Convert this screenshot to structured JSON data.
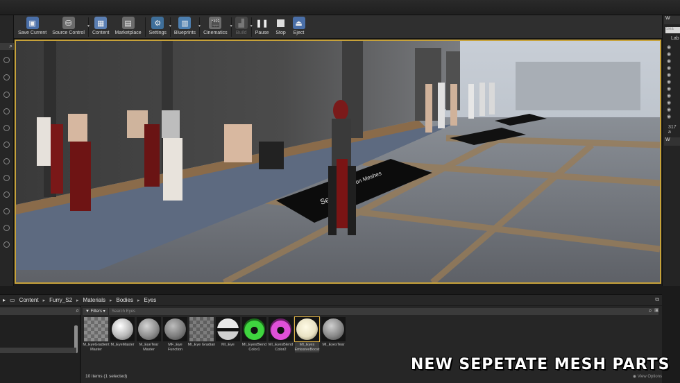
{
  "toolbar": {
    "buttons": [
      {
        "label": "Save Current",
        "icon": "save-icon",
        "color": "#4a6fa8"
      },
      {
        "label": "Source Control",
        "icon": "source-control-icon",
        "color": "#7a7a7a"
      },
      {
        "label": "Content",
        "icon": "content-icon",
        "color": "#5b7fb3"
      },
      {
        "label": "Marketplace",
        "icon": "marketplace-icon",
        "color": "#6c6c6c"
      },
      {
        "label": "Settings",
        "icon": "settings-icon",
        "color": "#3f6f9a"
      },
      {
        "label": "Blueprints",
        "icon": "blueprints-icon",
        "color": "#4d7fb0"
      },
      {
        "label": "Cinematics",
        "icon": "cinematics-icon",
        "color": "#6d6d6d"
      },
      {
        "label": "Build",
        "icon": "build-icon",
        "color": "#4a4a4a"
      },
      {
        "label": "Pause",
        "icon": "pause-icon",
        "color": "#2f2f2f"
      },
      {
        "label": "Stop",
        "icon": "stop-icon",
        "color": "#2f2f2f"
      },
      {
        "label": "Eject",
        "icon": "eject-icon",
        "color": "#4a6fa8"
      }
    ]
  },
  "viewport": {
    "sign_text_near": "Se",
    "sign_text_far": "ration Meshes"
  },
  "right_panel": {
    "tab": "W",
    "search": "Sea",
    "label": "Lab",
    "count": "317 a",
    "tab2": "W"
  },
  "breadcrumb": [
    "Content",
    "Furry_S2",
    "Materials",
    "Bodies",
    "Eyes"
  ],
  "content_browser": {
    "filters_label": "Filters",
    "search_placeholder": "Search Eyes",
    "assets": [
      {
        "name": "M_EyeGradient Master",
        "kind": "checker"
      },
      {
        "name": "M_EyeMaster",
        "kind": "sphere-white"
      },
      {
        "name": "M_EyeTear Master",
        "kind": "sphere-grey"
      },
      {
        "name": "MF_Eye Function",
        "kind": "sphere-grey"
      },
      {
        "name": "MI_Eye Gradian",
        "kind": "checker"
      },
      {
        "name": "MI_Eye",
        "kind": "sphere-eye"
      },
      {
        "name": "MI_EyesBlend Color1",
        "kind": "sphere-green"
      },
      {
        "name": "MI_EyesBlend Color2",
        "kind": "sphere-pink"
      },
      {
        "name": "MI_Eyes EmissiveBoost",
        "kind": "sphere-bright",
        "selected": true
      },
      {
        "name": "MI_EyesTear",
        "kind": "sphere-grey"
      }
    ],
    "status": "10 items (1 selected)",
    "view_options": "View Options"
  },
  "caption": "New Sepetate Mesh Parts"
}
